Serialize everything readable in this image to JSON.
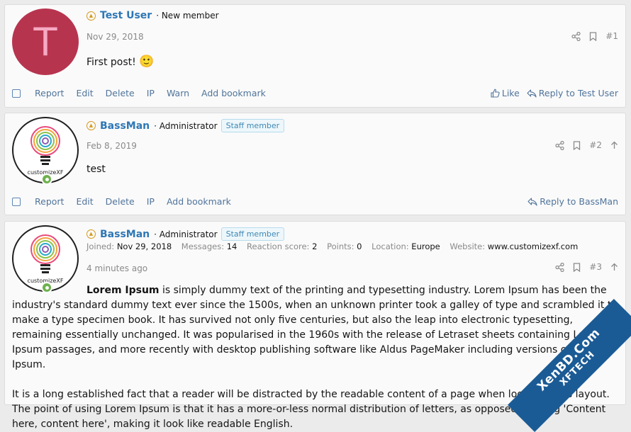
{
  "posts": [
    {
      "avatar_letter": "T",
      "username": "Test User",
      "role": "New member",
      "date": "Nov 29, 2018",
      "number": "#1",
      "text": "First post!",
      "emoji": "🙂",
      "actions": [
        "Report",
        "Edit",
        "Delete",
        "IP",
        "Warn",
        "Add bookmark"
      ],
      "like_label": "Like",
      "reply_label": "Reply to Test User"
    },
    {
      "avatar_caption": "customizeXF",
      "username": "BassMan",
      "role": "Administrator",
      "badge": "Staff member",
      "date": "Feb 8, 2019",
      "number": "#2",
      "text": "test",
      "actions": [
        "Report",
        "Edit",
        "Delete",
        "IP",
        "Add bookmark"
      ],
      "reply_label": "Reply to BassMan"
    },
    {
      "avatar_caption": "customizeXF",
      "username": "BassMan",
      "role": "Administrator",
      "badge": "Staff member",
      "stats": {
        "joined_label": "Joined:",
        "joined": "Nov 29, 2018",
        "messages_label": "Messages:",
        "messages": "14",
        "reaction_label": "Reaction score:",
        "reaction": "2",
        "points_label": "Points:",
        "points": "0",
        "location_label": "Location:",
        "location": "Europe",
        "website_label": "Website:",
        "website": "www.customizexf.com"
      },
      "date": "4 minutes ago",
      "number": "#3",
      "para1_bold": "Lorem Ipsum",
      "para1_rest": " is simply dummy text of the printing and typesetting industry. Lorem Ipsum has been the industry's standard dummy text ever since the 1500s, when an unknown printer took a galley of type and scrambled it to make a type specimen book. It has survived not only five centuries, but also the leap into electronic typesetting, remaining essentially unchanged. It was popularised in the 1960s with the release of Letraset sheets containing Lorem Ipsum passages, and more recently with desktop publishing software like Aldus PageMaker including versions of Lorem Ipsum.",
      "para2": "It is a long established fact that a reader will be distracted by the readable content of a page when looking at its layout. The point of using Lorem Ipsum is that it has a more-or-less normal distribution of letters, as opposed to using 'Content here, content here', making it look like readable English."
    }
  ],
  "watermark": {
    "line1": "XenBD.Com",
    "line2": "XFTECH"
  },
  "colors": {
    "link": "#2e77b5",
    "action": "#50749b",
    "avatar_bg": "#b7344f"
  }
}
